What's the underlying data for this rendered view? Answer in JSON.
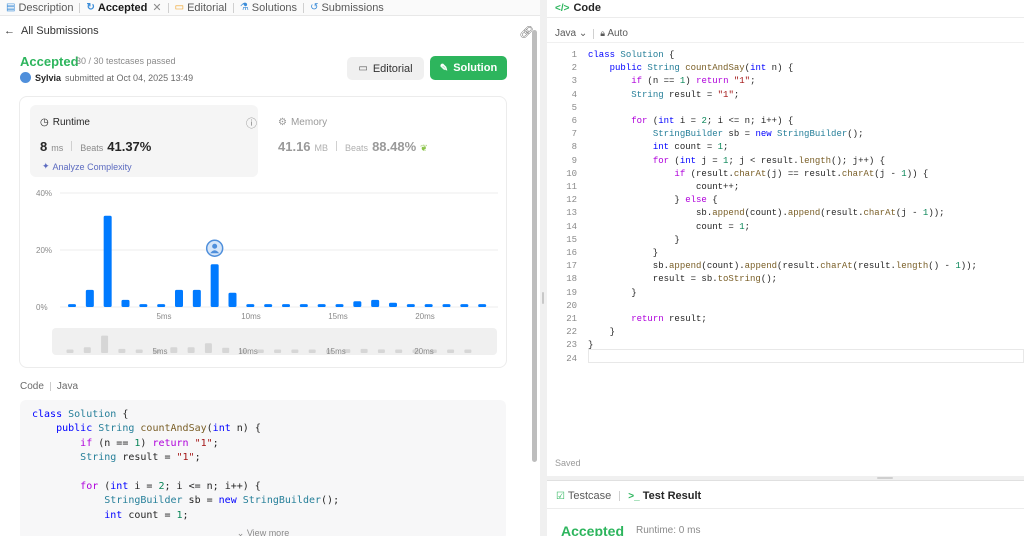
{
  "tabs": [
    {
      "label": "Description",
      "icon": "description-icon"
    },
    {
      "label": "Accepted",
      "icon": "history-icon",
      "active": true
    },
    {
      "label": "Editorial",
      "icon": "book-icon"
    },
    {
      "label": "Solutions",
      "icon": "flask-icon"
    },
    {
      "label": "Submissions",
      "icon": "history-icon"
    }
  ],
  "nav": {
    "back_label": "All Submissions"
  },
  "result": {
    "status": "Accepted",
    "tests": "30 / 30 testcases passed",
    "user": "Sylvia",
    "submitted": "submitted at Oct 04, 2025 13:49"
  },
  "buttons": {
    "editorial": "Editorial",
    "solution": "Solution"
  },
  "runtime": {
    "title": "Runtime",
    "value": "8",
    "unit": "ms",
    "beats_label": "Beats",
    "beats": "41.37%",
    "analyze": "Analyze Complexity"
  },
  "memory": {
    "title": "Memory",
    "value": "41.16",
    "unit": "MB",
    "beats_label": "Beats",
    "beats": "88.48%"
  },
  "chart_data": {
    "type": "bar",
    "ylabels": [
      "40%",
      "20%",
      "0%"
    ],
    "ylim": [
      0,
      40
    ],
    "xlabels": [
      "5ms",
      "10ms",
      "15ms",
      "20ms"
    ],
    "values": [
      1,
      6,
      32,
      2.5,
      1,
      1,
      6,
      6,
      15,
      5,
      1,
      1,
      1,
      1,
      1,
      1,
      2,
      2.5,
      1.5,
      1,
      1,
      1,
      1,
      1
    ],
    "highlight_index": 8,
    "accent": "#007aff"
  },
  "code_section": {
    "label": "Code",
    "lang": "Java",
    "view_more": "View more"
  },
  "editor": {
    "tab": "Code",
    "lang": "Java",
    "mode": "Auto",
    "saved": "Saved",
    "lines": 24
  },
  "bottom": {
    "testcase_tab": "Testcase",
    "result_tab": "Test Result",
    "status": "Accepted",
    "runtime": "Runtime: 0 ms"
  }
}
